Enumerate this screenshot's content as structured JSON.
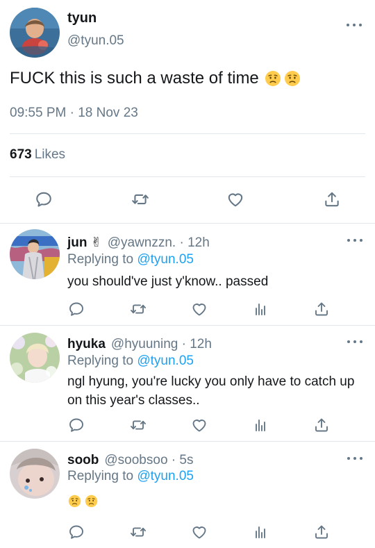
{
  "main_tweet": {
    "display_name": "tyun",
    "handle": "@tyun.05",
    "text": "FUCK this is such a waste of time",
    "emojis": [
      "worried-face-emoji",
      "worried-face-emoji"
    ],
    "timestamp": "09:55 PM · 18 Nov 23",
    "likes_count": "673",
    "likes_label": "Likes",
    "actions": [
      "reply-icon",
      "retweet-icon",
      "like-icon",
      "share-icon"
    ]
  },
  "replies": [
    {
      "display_name": "jun ✌",
      "meta": "@yawnzzn. · 12h",
      "replying_prefix": "Replying to",
      "replying_handle": "@tyun.05",
      "text": "you should've just y'know.. passed",
      "actions": [
        "reply-icon",
        "retweet-icon",
        "like-icon",
        "analytics-icon",
        "share-icon"
      ]
    },
    {
      "display_name": "hyuka",
      "meta": "@hyuuning · 12h",
      "replying_prefix": "Replying to",
      "replying_handle": "@tyun.05",
      "text": "ngl hyung, you're lucky you only have to catch up on this year's classes..",
      "actions": [
        "reply-icon",
        "retweet-icon",
        "like-icon",
        "analytics-icon",
        "share-icon"
      ]
    },
    {
      "display_name": "soob",
      "meta": "@soobsoo · 5s",
      "replying_prefix": "Replying to",
      "replying_handle": "@tyun.05",
      "emojis": [
        "worried-face-emoji",
        "worried-face-emoji"
      ],
      "actions": [
        "reply-icon",
        "retweet-icon",
        "like-icon",
        "analytics-icon",
        "share-icon"
      ]
    }
  ],
  "colors": {
    "text": "#14171a",
    "secondary": "#657786",
    "link": "#1da1f2",
    "divider": "#e1e8ed",
    "emoji_face": "#ffcc4d"
  }
}
